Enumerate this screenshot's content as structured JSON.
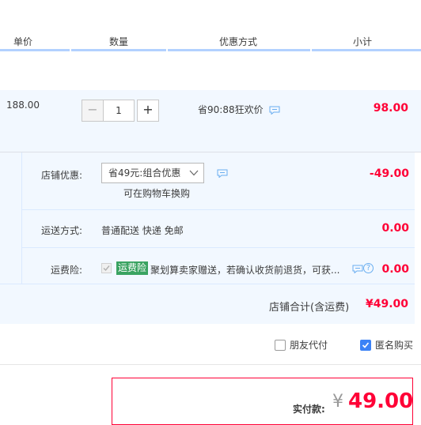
{
  "header": {
    "unit_price": "单价",
    "quantity": "数量",
    "discount_method": "优惠方式",
    "subtotal": "小计"
  },
  "item": {
    "price": "188.00",
    "quantity": "1",
    "minus": "−",
    "plus": "+",
    "promo": "省90:88狂欢价",
    "subtotal": "98.00"
  },
  "shop_discount": {
    "label": "店铺优惠:",
    "selected": "省49元:组合优惠",
    "note": "可在购物车换购",
    "amount": "-49.00"
  },
  "shipping": {
    "label": "运送方式:",
    "value": "普通配送 快递 免邮",
    "amount": "0.00"
  },
  "insurance": {
    "label": "运费险:",
    "badge": "运费险",
    "text": "聚划算卖家赠送，若确认收货前退货，可获...",
    "amount": "0.00",
    "help": "?"
  },
  "shop_total": {
    "label": "店铺合计(含运费)",
    "value": "¥49.00"
  },
  "options": {
    "friend_pay": "朋友代付",
    "anonymous": "匿名购买",
    "friend_pay_checked": false,
    "anonymous_checked": true
  },
  "payment": {
    "label": "实付款:",
    "currency": "¥",
    "value": "49.00"
  },
  "colors": {
    "accent_red": "#ff0036",
    "light_blue_bg": "#f2f8ff",
    "insurance_green": "#3aa361",
    "checkbox_blue": "#3b82f6"
  },
  "icons": [
    "chat-icon",
    "chevron-down-icon",
    "help-icon",
    "check-icon"
  ]
}
